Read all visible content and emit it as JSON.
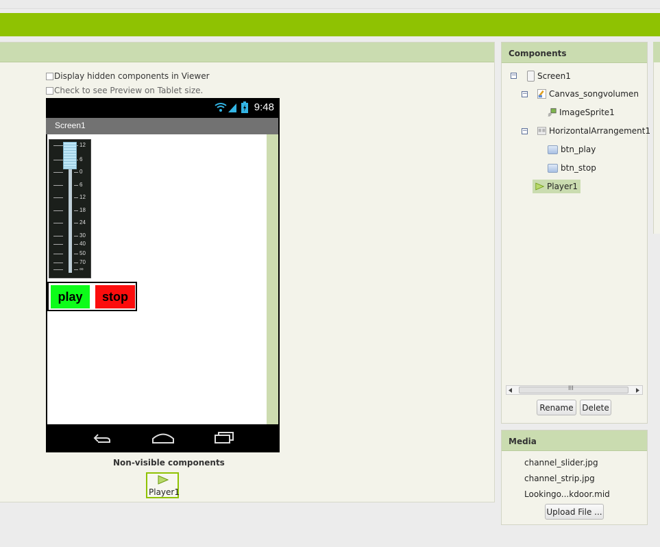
{
  "viewer": {
    "checkbox_hidden_label": "Display hidden components in Viewer",
    "checkbox_tablet_label": "Check to see Preview on Tablet size.",
    "phone": {
      "time": "9:48",
      "screen_title": "Screen1",
      "slider_labels": [
        "12",
        "6",
        "0",
        "6",
        "12",
        "18",
        "24",
        "30",
        "40",
        "50",
        "70",
        "∞"
      ],
      "play_label": "play",
      "stop_label": "stop"
    },
    "nonvisible_label": "Non-visible components",
    "player_label": "Player1"
  },
  "components": {
    "title": "Components",
    "tree": [
      {
        "label": "Screen1",
        "icon": "screen-icon"
      },
      {
        "label": "Canvas_songvolumen",
        "icon": "canvas-icon"
      },
      {
        "label": "ImageSprite1",
        "icon": "image-sprite-icon"
      },
      {
        "label": "HorizontalArrangement1",
        "icon": "horizontal-arrangement-icon"
      },
      {
        "label": "btn_play",
        "icon": "button-icon"
      },
      {
        "label": "btn_stop",
        "icon": "button-icon"
      },
      {
        "label": "Player1",
        "icon": "player-icon",
        "selected": true
      }
    ],
    "scroll_grip": "III",
    "rename_label": "Rename",
    "delete_label": "Delete"
  },
  "media": {
    "title": "Media",
    "files": [
      "channel_slider.jpg",
      "channel_strip.jpg",
      "Lookingo...kdoor.mid"
    ],
    "upload_label": "Upload File ..."
  },
  "colors": {
    "accent_green": "#8fc202",
    "header_green": "#cadcb0",
    "play_button": "#0dfc19",
    "stop_button": "#fb0d0d"
  }
}
